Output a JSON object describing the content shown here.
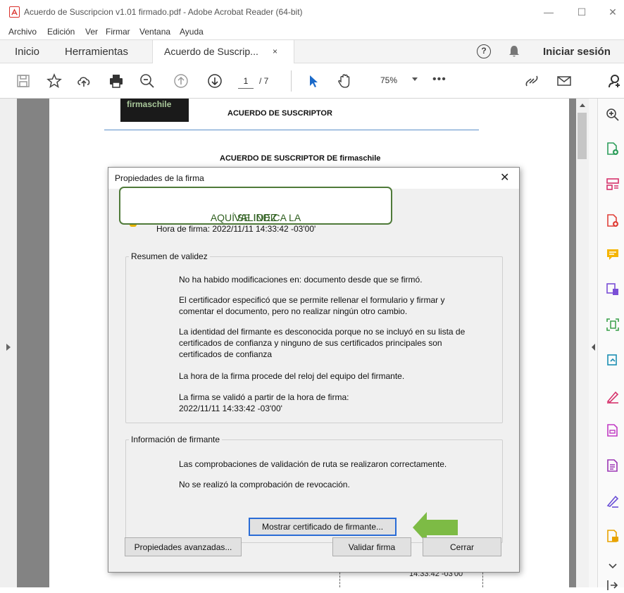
{
  "window": {
    "title": "Acuerdo de Suscripcion v1.01 firmado.pdf - Adobe Acrobat Reader (64-bit)",
    "minimize": "—",
    "maximize": "☐",
    "close": "✕"
  },
  "menu": [
    "Archivo",
    "Edición",
    "Ver",
    "Firmar",
    "Ventana",
    "Ayuda"
  ],
  "tabs": {
    "home": "Inicio",
    "tools": "Herramientas",
    "document": "Acuerdo de Suscrip...",
    "document_close": "×",
    "help": "?",
    "signin": "Iniciar sesión"
  },
  "toolbar": {
    "page_current": "1",
    "page_total": "/ 7",
    "zoom": "75%",
    "more": "•••"
  },
  "document": {
    "logo_text": "firmaschile",
    "heading": "ACUERDO DE SUSCRIPTOR",
    "subheading": "ACUERDO DE SUSCRIPTOR DE firmaschile",
    "signature_time": "14:33:42 -03'00'"
  },
  "dialog": {
    "title": "Propiedades de la firma",
    "close": "✕",
    "callout_prefix": "AQUÍ SE INDICA LA ",
    "callout_emphasis": "VALIDEZ",
    "signing_time": "Hora de firma:  2022/11/11 14:33:42 -03'00'",
    "validity_summary": {
      "legend": "Resumen de validez",
      "items": [
        "No ha habido modificaciones en: documento desde que se firmó.",
        "El certificador especificó que se permite rellenar el formulario y firmar y comentar el documento, pero no realizar ningún otro cambio.",
        "La identidad del firmante es desconocida porque no se incluyó en su lista de certificados de confianza y ninguno de sus certificados principales son certificados de confianza",
        "La hora de la firma procede del reloj del equipo del firmante.",
        "La firma se validó a partir de la hora de firma: 2022/11/11 14:33:42 -03'00'"
      ]
    },
    "signer_info": {
      "legend": "Información de firmante",
      "items": [
        "Las comprobaciones de validación de ruta se realizaron correctamente.",
        "No se realizó la comprobación de revocación."
      ],
      "show_certificate": "Mostrar certificado de firmante..."
    },
    "buttons": {
      "advanced": "Propiedades avanzadas...",
      "validate": "Validar firma",
      "close": "Cerrar"
    }
  },
  "colors": {
    "callout_border": "#4f7a39",
    "arrow": "#7dbb45",
    "focus": "#2a6cd6"
  }
}
